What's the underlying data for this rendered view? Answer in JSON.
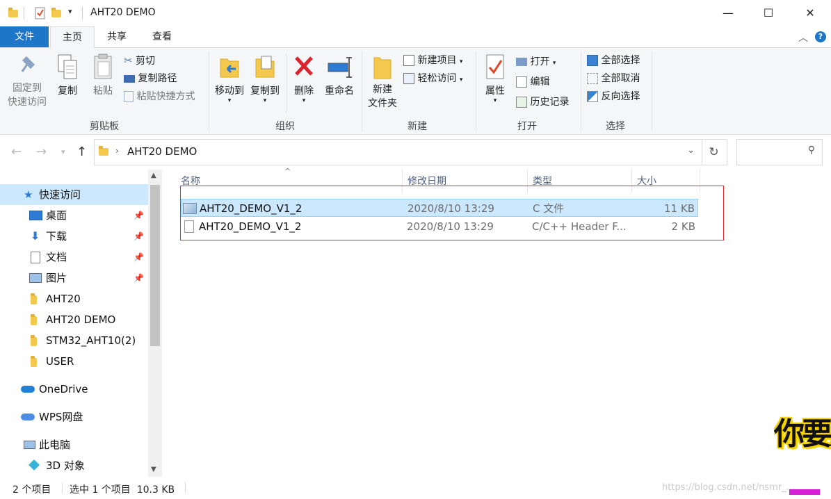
{
  "window": {
    "title": "AHT20 DEMO",
    "minimize": "—",
    "maximize": "☐",
    "close": "✕"
  },
  "tabs": {
    "file": "文件",
    "home": "主页",
    "share": "共享",
    "view": "查看"
  },
  "ribbon": {
    "clipboard": {
      "label": "剪贴板",
      "pin_quick": "固定到\n快速访问",
      "copy": "复制",
      "paste": "粘贴",
      "cut": "剪切",
      "copy_path": "复制路径",
      "paste_shortcut": "粘贴快捷方式"
    },
    "organize": {
      "label": "组织",
      "move_to": "移动到",
      "copy_to": "复制到",
      "delete": "删除",
      "rename": "重命名"
    },
    "new": {
      "label": "新建",
      "new_folder": "新建\n文件夹",
      "new_item": "新建项目",
      "easy_access": "轻松访问"
    },
    "open": {
      "label": "打开",
      "properties": "属性",
      "open": "打开",
      "edit": "编辑",
      "history": "历史记录"
    },
    "select": {
      "label": "选择",
      "select_all": "全部选择",
      "select_none": "全部取消",
      "invert": "反向选择"
    }
  },
  "address": {
    "path": "AHT20 DEMO"
  },
  "nav": {
    "quick_access": "快速访问",
    "items": [
      {
        "label": "桌面",
        "pinned": true
      },
      {
        "label": "下载",
        "pinned": true
      },
      {
        "label": "文档",
        "pinned": true
      },
      {
        "label": "图片",
        "pinned": true
      },
      {
        "label": "AHT20",
        "pinned": false
      },
      {
        "label": "AHT20 DEMO",
        "pinned": false
      },
      {
        "label": "STM32_AHT10(2)",
        "pinned": false
      },
      {
        "label": "USER",
        "pinned": false
      }
    ],
    "onedrive": "OneDrive",
    "wps": "WPS网盘",
    "this_pc": "此电脑",
    "objects_3d": "3D 对象"
  },
  "columns": {
    "name": "名称",
    "date": "修改日期",
    "type": "类型",
    "size": "大小"
  },
  "files": [
    {
      "name": "AHT20_DEMO_V1_2",
      "date": "2020/8/10 13:29",
      "type": "C 文件",
      "size": "11 KB"
    },
    {
      "name": "AHT20_DEMO_V1_2",
      "date": "2020/8/10 13:29",
      "type": "C/C++ Header F...",
      "size": "2 KB"
    }
  ],
  "status": {
    "count": "2 个项目",
    "selection": "选中 1 个项目  10.3 KB"
  },
  "watermark": "https://blog.csdn.net/nsmr_...",
  "overlay_text": "你要属",
  "colors": {
    "accent": "#1e76c8",
    "selection": "#cce8ff",
    "red_box": "#e8262a"
  }
}
